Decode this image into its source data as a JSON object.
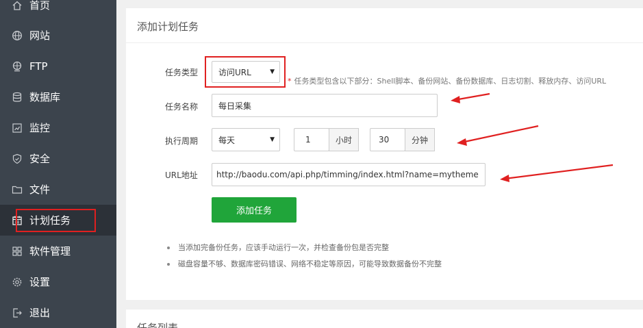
{
  "sidebar": {
    "items": [
      {
        "label": "首页",
        "icon": "home-icon"
      },
      {
        "label": "网站",
        "icon": "globe-icon"
      },
      {
        "label": "FTP",
        "icon": "ftp-globe-icon"
      },
      {
        "label": "数据库",
        "icon": "database-icon"
      },
      {
        "label": "监控",
        "icon": "monitor-icon"
      },
      {
        "label": "安全",
        "icon": "shield-icon"
      },
      {
        "label": "文件",
        "icon": "folder-icon"
      },
      {
        "label": "计划任务",
        "icon": "calendar-icon",
        "active": true
      },
      {
        "label": "软件管理",
        "icon": "grid-icon"
      },
      {
        "label": "设置",
        "icon": "gear-icon"
      },
      {
        "label": "退出",
        "icon": "logout-icon"
      }
    ]
  },
  "add_task": {
    "title": "添加计划任务",
    "task_type": {
      "label": "任务类型",
      "value": "访问URL",
      "hint": "任务类型包含以下部分：Shell脚本、备份网站、备份数据库、日志切割、释放内存、访问URL",
      "hint_star": "*"
    },
    "task_name": {
      "label": "任务名称",
      "value": "每日采集"
    },
    "period": {
      "label": "执行周期",
      "value": "每天",
      "hour_value": "1",
      "hour_unit": "小时",
      "minute_value": "30",
      "minute_unit": "分钟"
    },
    "url": {
      "label": "URL地址",
      "value": "http://baodu.com/api.php/timming/index.html?name=mytheme"
    },
    "submit_label": "添加任务",
    "notes": [
      "当添加完备份任务，应该手动运行一次，并检查备份包是否完整",
      "磁盘容量不够、数据库密码错误、网络不稳定等原因，可能导致数据备份不完整"
    ]
  },
  "task_list": {
    "title": "任务列表"
  },
  "colors": {
    "sidebar_bg": "#3c444d",
    "sidebar_active": "#2c3138",
    "accent_green": "#20a53a",
    "annotation_red": "#e02020"
  }
}
